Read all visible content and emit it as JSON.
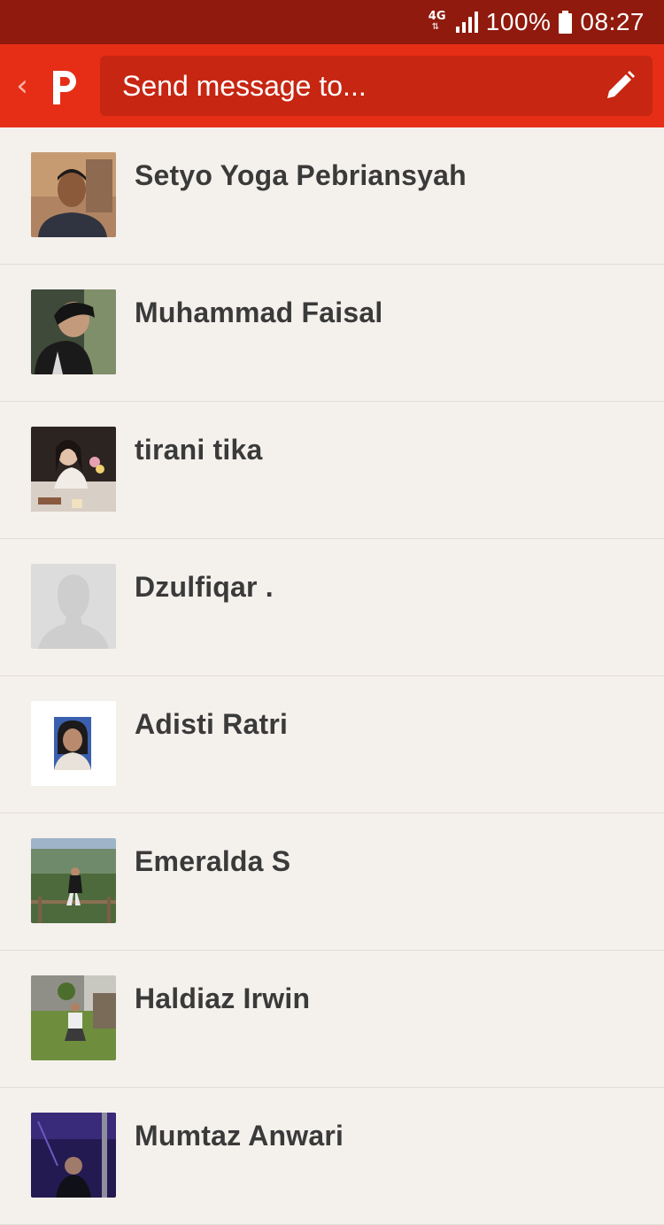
{
  "status_bar": {
    "network_label": "4G",
    "battery_percent": "100%",
    "time": "08:27"
  },
  "app_bar": {
    "search_placeholder": "Send message to..."
  },
  "contacts": [
    {
      "name": "Setyo Yoga Pebriansyah"
    },
    {
      "name": "Muhammad Faisal"
    },
    {
      "name": "tirani tika"
    },
    {
      "name": "Dzulfiqar ."
    },
    {
      "name": "Adisti Ratri"
    },
    {
      "name": "Emeralda S"
    },
    {
      "name": "Haldiaz Irwin"
    },
    {
      "name": "Mumtaz Anwari"
    }
  ],
  "colors": {
    "status_bar": "#8f1a0d",
    "app_bar": "#e62e17",
    "search_box": "#c72612",
    "list_background": "#f4f0ec",
    "name_text": "#3a3a3a"
  }
}
